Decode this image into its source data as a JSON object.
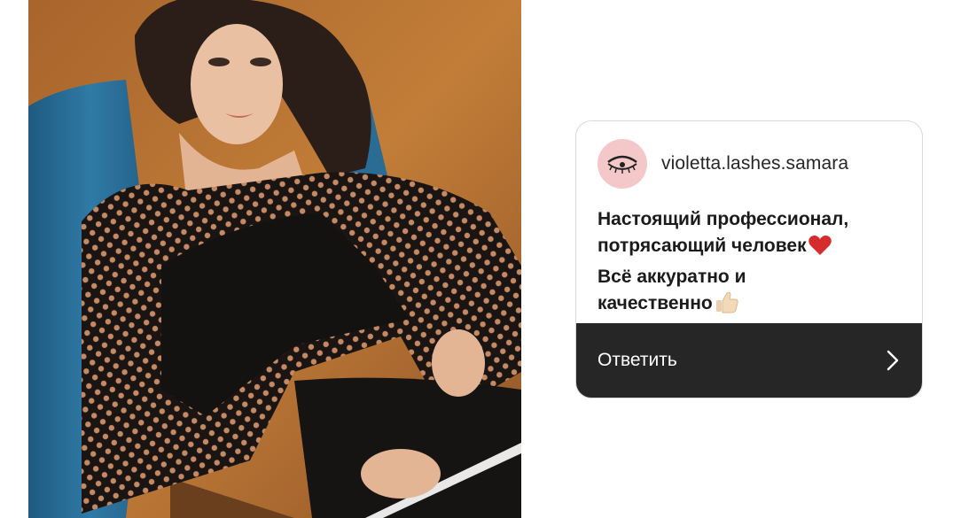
{
  "photo": {
    "alt_icon": "portrait-photo"
  },
  "card": {
    "username": "violetta.lashes.samara",
    "avatar_icon": "eyelash-logo-icon",
    "message_lines": [
      "Настоящий профессионал,",
      "потрясающий человек",
      "Всё аккуратно и",
      "качественно"
    ],
    "heart_icon": "red-heart-emoji",
    "thumb_icon": "thumbs-up-emoji",
    "reply_label": "Ответить",
    "reply_icon": "chevron-right-icon"
  },
  "colors": {
    "reply_bar": "#262626",
    "avatar_bg": "#f4c8c8",
    "heart": "#d62c2c",
    "photo_wall": "#b8722f",
    "chair": "#2c6e96"
  }
}
